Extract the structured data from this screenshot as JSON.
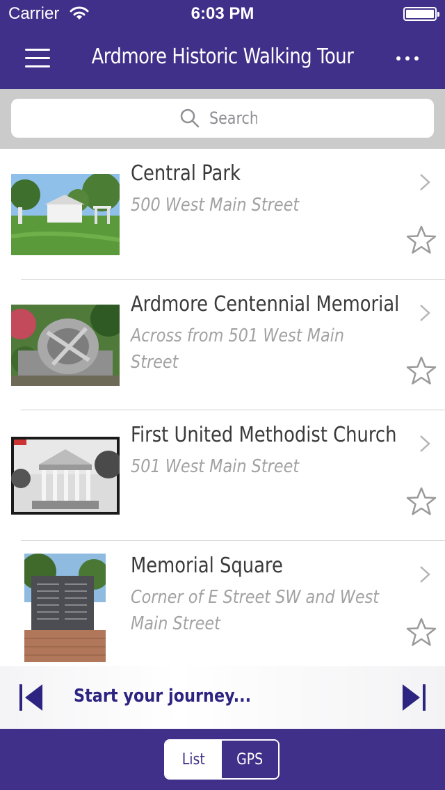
{
  "status_bar": {
    "carrier": "Carrier",
    "time": "6:03 PM"
  },
  "nav": {
    "title": "Ardmore Historic Walking Tour",
    "menu_icon": "hamburger-icon",
    "more_icon": "more-dots-icon"
  },
  "search": {
    "placeholder": "Search"
  },
  "locations": [
    {
      "name": "Central Park",
      "address": "500 West Main Street"
    },
    {
      "name": "Ardmore Centennial Memorial",
      "address": "Across from 501 West Main Street"
    },
    {
      "name": "First United Methodist Church",
      "address": "501 West Main Street"
    },
    {
      "name": "Memorial Square",
      "address": "Corner of E Street SW and West Main Street"
    }
  ],
  "player": {
    "label": "Start your journey..."
  },
  "view_toggle": {
    "list_label": "List",
    "gps_label": "GPS",
    "selected": "List"
  },
  "colors": {
    "brand_purple": "#40308a",
    "player_text": "#2c2480",
    "address_gray": "#a2a2a2"
  }
}
